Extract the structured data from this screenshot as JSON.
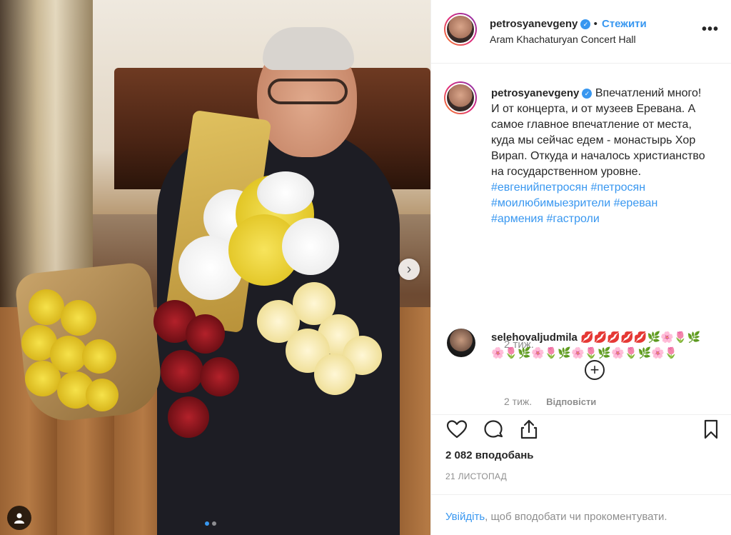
{
  "post": {
    "username": "petrosyanevgeny",
    "verified_icon": "verified-badge-icon",
    "follow_label": "Стежити",
    "location": "Aram Khachaturyan Concert Hall",
    "more_icon": "more-options-icon",
    "more_label": "•••"
  },
  "caption": {
    "username": "petrosyanevgeny",
    "text": "Впечатлений много! И от концерта, и от музеев Еревана. А самое главное впечатление от места, куда мы сейчас едем - монастырь Хор Вирап. Откуда и началось христианство на государственном уровне.",
    "hashtags": "#евгенийпетросян #петросян #моилюбимыезрители #ереван #армения #гастроли",
    "time": "2 тиж.",
    "expand_label": "+"
  },
  "comment": {
    "username": "selehovaljudmila",
    "text": "💋💋💋💋💋🌿🌸🌷🌿🌸🌷🌿🌸🌷🌿🌸🌷🌿🌸🌷🌿🌸🌷",
    "time": "2 тиж.",
    "reply_label": "Відповісти"
  },
  "actions": {
    "likes": "2 082 вподобань",
    "date": "21 ЛИСТОПАД",
    "login_link": "Увійдіть",
    "login_rest": ", щоб вподобати чи прокоментувати."
  },
  "carousel": {
    "next_label": "›",
    "slides": 2,
    "active_slide": 1
  },
  "colors": {
    "accent": "#3897f0",
    "text": "#262626",
    "muted": "#8e8e8e",
    "border": "#efefef"
  }
}
